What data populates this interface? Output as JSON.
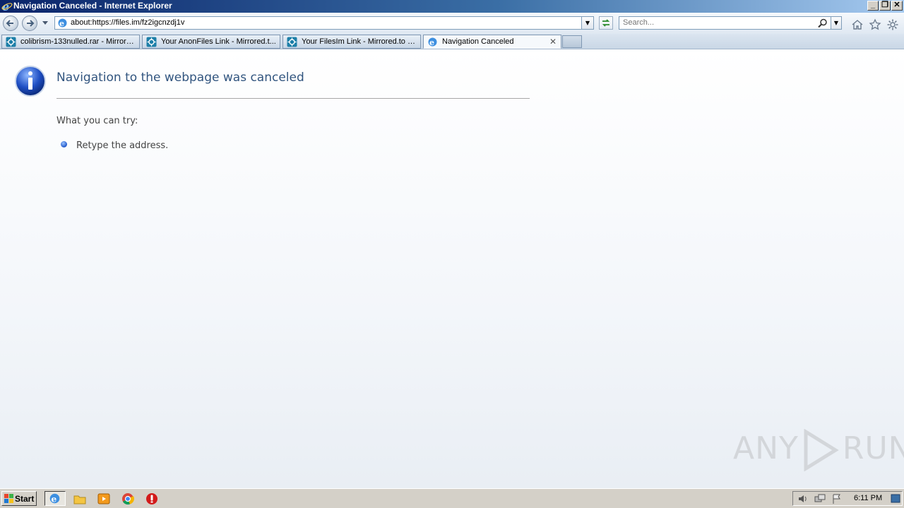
{
  "window": {
    "title": "Navigation Canceled - Internet Explorer",
    "buttons": {
      "minimize": "_",
      "maximize": "❐",
      "close": "✕"
    }
  },
  "address_bar": {
    "url": "about:https://files.im/fz2igcnzdj1v",
    "dropdown": "▼"
  },
  "search": {
    "placeholder": "Search...",
    "dropdown": "▼"
  },
  "toolbar_icons": [
    "home-icon",
    "favorites-star-icon",
    "gear-icon"
  ],
  "tabs": [
    {
      "label": "colibrism-133nulled.rar - Mirrore...",
      "active": false,
      "icon": "site-icon"
    },
    {
      "label": "Your AnonFiles Link - Mirrored.t...",
      "active": false,
      "icon": "site-icon"
    },
    {
      "label": "Your FilesIm Link - Mirrored.to - ...",
      "active": false,
      "icon": "site-icon"
    },
    {
      "label": "Navigation Canceled",
      "active": true,
      "icon": "ie-page-icon",
      "close": "✕"
    }
  ],
  "content": {
    "heading": "Navigation to the webpage was canceled",
    "try_label": "What you can try:",
    "suggestions": [
      "Retype the address."
    ]
  },
  "watermark": {
    "left": "ANY",
    "right": "RUN"
  },
  "taskbar": {
    "start_label": "Start",
    "clock": "6:11 PM"
  },
  "colors": {
    "heading": "#32557f",
    "titlebar_start": "#0a246a",
    "titlebar_end": "#a6caf0",
    "taskbar": "#d4d0c8"
  }
}
